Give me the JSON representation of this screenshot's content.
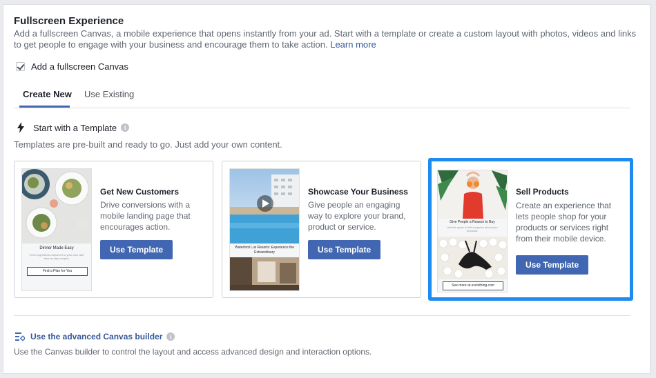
{
  "section": {
    "title": "Fullscreen Experience",
    "description": "Add a fullscreen Canvas, a mobile experience that opens instantly from your ad. Start with a template or create a custom layout with photos, videos and links to get people to engage with your business and encourage them to take action.",
    "learn_more": "Learn more"
  },
  "checkbox": {
    "label": "Add a fullscreen Canvas",
    "checked": true
  },
  "tabs": [
    {
      "label": "Create New",
      "active": true
    },
    {
      "label": "Use Existing",
      "active": false
    }
  ],
  "templates_section": {
    "heading": "Start with a Template",
    "subtext": "Templates are pre-built and ready to go. Just add your own content."
  },
  "cards": [
    {
      "title": "Get New Customers",
      "text": "Drive conversions with a mobile landing page that encourages action.",
      "button": "Use Template",
      "thumb": {
        "caption": "Dinner Made Easy",
        "body": "Fresh ingredients delivered to your door with step-by-step recipes.",
        "cta": "Find a Plan for You"
      }
    },
    {
      "title": "Showcase Your Business",
      "text": "Give people an engaging way to explore your brand, product or service.",
      "button": "Use Template",
      "thumb": {
        "caption": "Waterford Lux Resorts: Experience the Extraordinary"
      }
    },
    {
      "title": "Sell Products",
      "text": "Create an experience that lets people shop for your products or services right from their mobile device.",
      "button": "Use Template",
      "selected": true,
      "thumb": {
        "caption": "Give People a Reason to Buy",
        "body": "Use the space to tell shoppers about your products.",
        "cta": "See more at exclothing.com"
      }
    }
  ],
  "advanced": {
    "label": "Use the advanced Canvas builder",
    "subtext": "Use the Canvas builder to control the layout and access advanced design and interaction options."
  },
  "colors": {
    "accent": "#4267b2",
    "selected_border": "#1d8bf1",
    "link": "#365899"
  },
  "icons": [
    "check-icon",
    "bolt-icon",
    "info-icon",
    "play-icon",
    "canvas-builder-icon"
  ]
}
